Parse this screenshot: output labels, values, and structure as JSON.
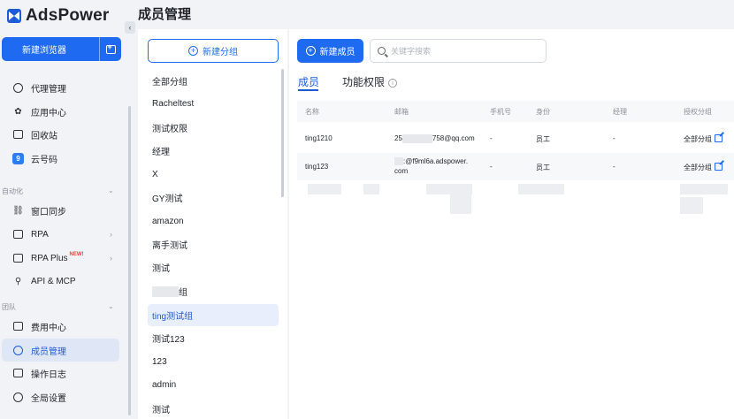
{
  "app": {
    "brand": "AdsPower"
  },
  "sidebar": {
    "new_browser_label": "新建浏览器",
    "items_top": [
      {
        "label": "代理管理",
        "icon": "proxy-icon"
      },
      {
        "label": "应用中心",
        "icon": "apps-icon"
      },
      {
        "label": "回收站",
        "icon": "trash-icon"
      },
      {
        "label": "云号码",
        "icon": "cloud-number-icon"
      }
    ],
    "section_automation": "自动化",
    "items_automation": [
      {
        "label": "窗口同步",
        "icon": "sync-icon"
      },
      {
        "label": "RPA",
        "icon": "rpa-icon"
      },
      {
        "label": "RPA Plus",
        "icon": "rpa-plus-icon",
        "badge": "NEW!"
      },
      {
        "label": "API & MCP",
        "icon": "api-icon"
      }
    ],
    "section_team": "团队",
    "items_team": [
      {
        "label": "费用中心",
        "icon": "billing-icon"
      },
      {
        "label": "成员管理",
        "icon": "members-icon",
        "active": true
      },
      {
        "label": "操作日志",
        "icon": "log-icon"
      },
      {
        "label": "全局设置",
        "icon": "settings-icon"
      }
    ]
  },
  "page": {
    "title": "成员管理"
  },
  "groups": {
    "new_group_label": "新建分组",
    "items": [
      "全部分组",
      "Racheltest",
      "测试权限",
      "经理",
      "X",
      "GY测试",
      "amazon",
      "离手测试",
      "测试",
      "组",
      "ting测试组",
      "测试123",
      "123",
      "admin",
      "测试"
    ]
  },
  "main": {
    "add_member_label": "新建成员",
    "search_placeholder": "关键字搜索",
    "tabs": [
      "成员",
      "功能权限"
    ],
    "columns": [
      "名称",
      "邮箱",
      "手机号",
      "身份",
      "经理",
      "授权分组"
    ],
    "rows": [
      {
        "name": "ting1210",
        "email_pre": "25",
        "email_post": "758@qq.com",
        "phone": "-",
        "role": "员工",
        "manager": "-",
        "groups": "全部分组"
      },
      {
        "name": "ting123",
        "email_line1": ":@f9ml6a.adspower.",
        "email_line2": "com",
        "phone": "-",
        "role": "员工",
        "manager": "-",
        "groups": "全部分组"
      }
    ]
  }
}
